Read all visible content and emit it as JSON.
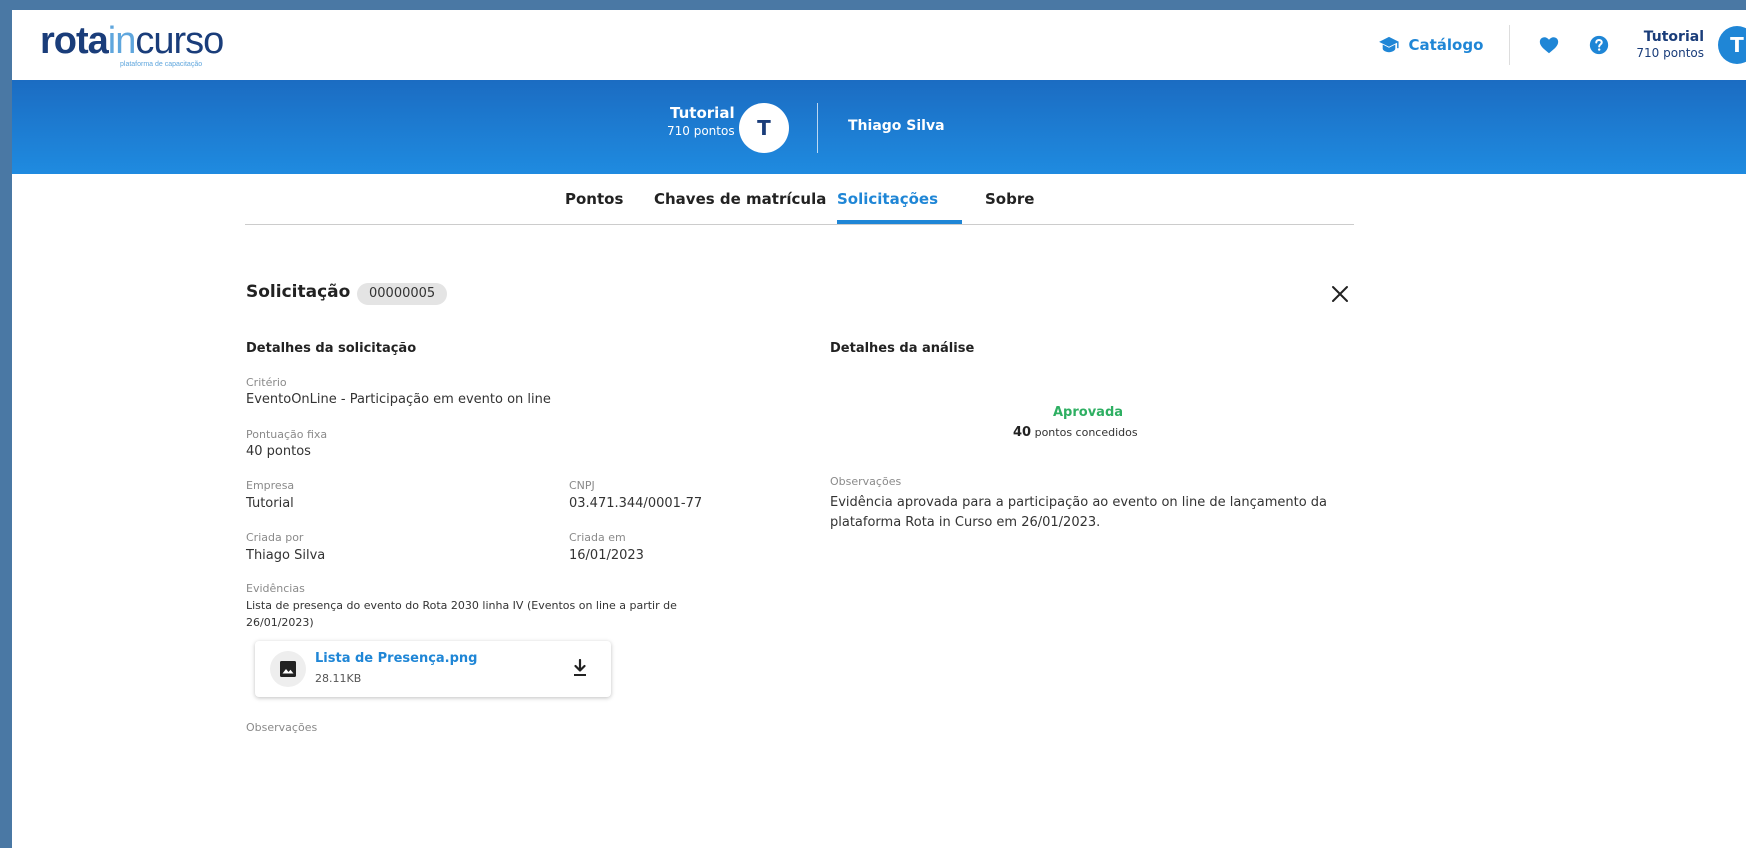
{
  "logo": {
    "rota": "rota",
    "in": "in",
    "curso": "curso",
    "tagline": "plataforma de capacitação"
  },
  "header": {
    "catalog_label": "Catálogo",
    "user_name": "Tutorial",
    "user_points": "710 pontos",
    "avatar_letter": "T"
  },
  "banner": {
    "user_name": "Tutorial",
    "user_points": "710 pontos",
    "avatar_letter": "T",
    "profile_name": "Thiago Silva"
  },
  "tabs": [
    {
      "label": "Pontos"
    },
    {
      "label": "Chaves de matrícula"
    },
    {
      "label": "Solicitações"
    },
    {
      "label": "Sobre"
    }
  ],
  "active_tab": "Solicitações",
  "request": {
    "title": "Solicitação",
    "number": "00000005",
    "details_title": "Detalhes da solicitação",
    "criteria_label": "Critério",
    "criteria_value": "EventoOnLine - Participação em evento on line",
    "fixed_score_label": "Pontuação fixa",
    "fixed_score_value": "40 pontos",
    "company_label": "Empresa",
    "company_value": "Tutorial",
    "cnpj_label": "CNPJ",
    "cnpj_value": "03.471.344/0001-77",
    "created_by_label": "Criada por",
    "created_by_value": "Thiago Silva",
    "created_at_label": "Criada em",
    "created_at_value": "16/01/2023",
    "evidence_label": "Evidências",
    "evidence_value": "Lista de presença do evento do Rota 2030 linha IV (Eventos on line a partir de 26/01/2023)",
    "file_name": "Lista de Presença.png",
    "file_size": "28.11KB",
    "observations_label": "Observações"
  },
  "analysis": {
    "title": "Detalhes da análise",
    "status": "Aprovada",
    "points_value": "40",
    "points_suffix": "pontos concedidos",
    "observations_label": "Observações",
    "observations_value": "Evidência aprovada para a participação ao evento on line de lançamento da plataforma Rota in Curso em 26/01/2023."
  },
  "colors": {
    "brand_blue": "#1f86d6",
    "brand_dark": "#1a3d7a",
    "approved_green": "#2eaf62",
    "frame_border": "#4a78a4"
  },
  "icons": {
    "catalog": "graduation-cap-icon",
    "favorites": "heart-icon",
    "help": "question-icon",
    "close": "close-icon",
    "file": "image-icon",
    "download": "download-icon"
  }
}
